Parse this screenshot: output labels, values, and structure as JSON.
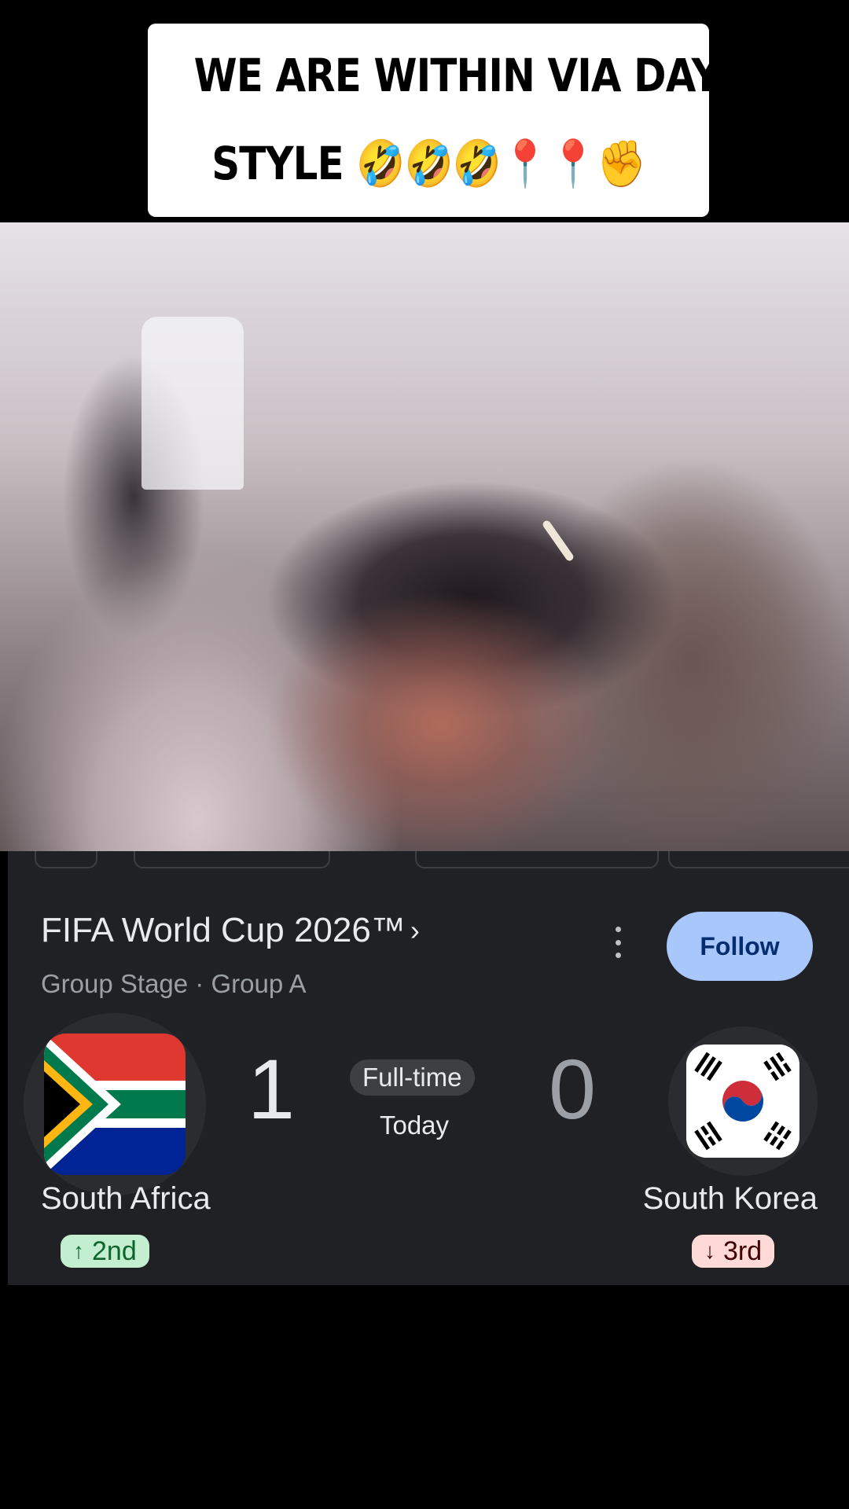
{
  "caption": {
    "line1": "WE ARE WITHIN VIA DAYVELA",
    "line2": "STYLE 🤣🤣🤣📍📍✊"
  },
  "scorecard": {
    "competition": "FIFA World Cup 2026™",
    "stage": "Group Stage · Group A",
    "follow_label": "Follow",
    "status": "Full-time",
    "date": "Today",
    "home": {
      "name": "South Africa",
      "score": "1",
      "rank": "2nd",
      "rank_direction": "up",
      "rank_color": "#c4eed0"
    },
    "away": {
      "name": "South Korea",
      "score": "0",
      "rank": "3rd",
      "rank_direction": "down",
      "rank_color": "#ffdad6"
    }
  },
  "colors": {
    "card_background": "#202124",
    "follow_button": "#a8c7fa"
  },
  "icons": {
    "chevron": "chevron-right-icon",
    "menu": "more-vert-icon",
    "up": "arrow-up-icon",
    "down": "arrow-down-icon"
  }
}
